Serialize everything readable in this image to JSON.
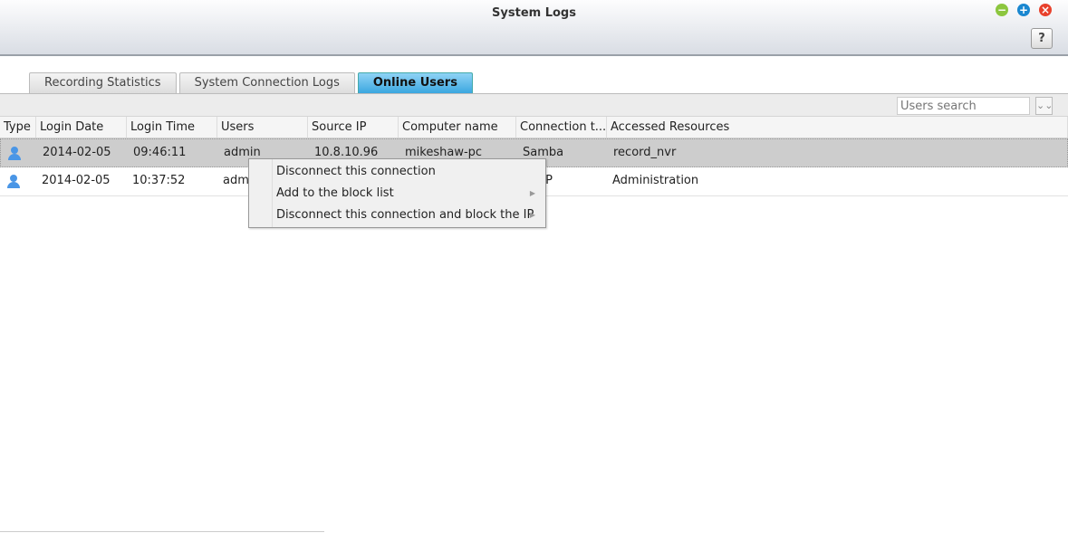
{
  "window": {
    "title": "System Logs",
    "help_label": "?"
  },
  "tabs": [
    {
      "label": "Recording Statistics"
    },
    {
      "label": "System Connection Logs"
    },
    {
      "label": "Online Users",
      "active": true
    }
  ],
  "search": {
    "placeholder": "Users search"
  },
  "columns": [
    "Type",
    "Login Date",
    "Login Time",
    "Users",
    "Source IP",
    "Computer name",
    "Connection t...",
    "Accessed Resources"
  ],
  "rows": [
    {
      "type": "user-icon",
      "date": "2014-02-05",
      "time": "09:46:11",
      "user": "admin",
      "ip": "10.8.10.96",
      "computer": "mikeshaw-pc",
      "conn": "Samba",
      "resources": "record_nvr",
      "selected": true
    },
    {
      "type": "user-icon",
      "date": "2014-02-05",
      "time": "10:37:52",
      "user": "adm",
      "ip": "",
      "computer": "",
      "conn": "P",
      "resources": "Administration"
    }
  ],
  "context_menu": [
    {
      "label": "Disconnect this connection"
    },
    {
      "label": "Add to the block list",
      "submenu": true
    },
    {
      "label": "Disconnect this connection and block the IP",
      "submenu": true
    }
  ],
  "colors": {
    "minimize": "#8cc63f",
    "maximize": "#1a87d0",
    "close": "#e8412c",
    "active_tab": "#3ba7e0",
    "user_icon": "#4a96e6"
  }
}
